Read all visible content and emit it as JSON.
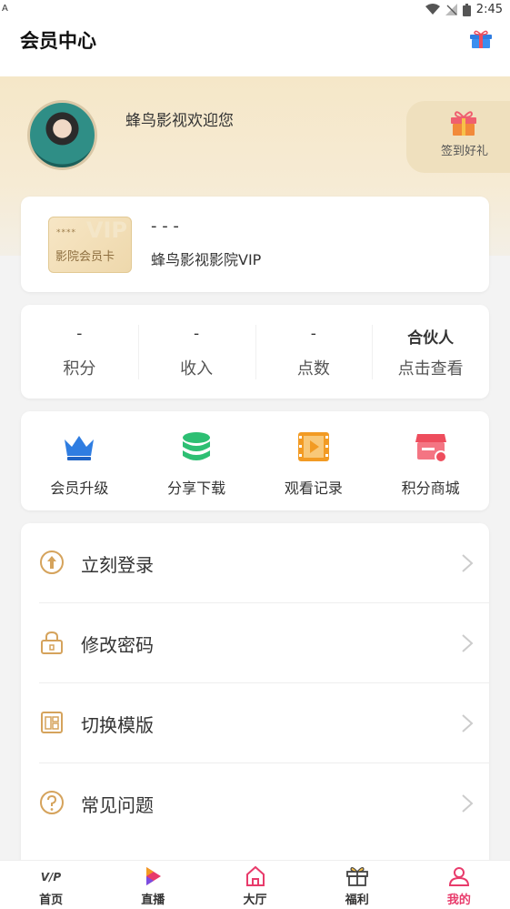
{
  "status_bar": {
    "left_indicator": "A",
    "time": "2:45"
  },
  "header": {
    "title": "会员中心",
    "gift_icon": "gift-icon"
  },
  "profile": {
    "welcome_text": "蜂鸟影视欢迎您",
    "signin_label": "签到好礼"
  },
  "vip_card": {
    "card_stars": "****",
    "card_watermark": "VIP",
    "card_name": "影院会员卡",
    "status": "- - -",
    "title": "蜂鸟影视影院VIP"
  },
  "stats": [
    {
      "value": "-",
      "label": "积分"
    },
    {
      "value": "-",
      "label": "收入"
    },
    {
      "value": "-",
      "label": "点数"
    },
    {
      "value": "合伙人",
      "label": "点击查看"
    }
  ],
  "quick_actions": [
    {
      "label": "会员升级",
      "icon": "crown-icon",
      "color": "#2f7de1"
    },
    {
      "label": "分享下载",
      "icon": "coin-stack-icon",
      "color": "#2dbf73"
    },
    {
      "label": "观看记录",
      "icon": "film-icon",
      "color": "#f29b24"
    },
    {
      "label": "积分商城",
      "icon": "store-icon",
      "color": "#ee4d5d"
    }
  ],
  "menu": [
    {
      "label": "立刻登录",
      "icon": "login-arrow-icon"
    },
    {
      "label": "修改密码",
      "icon": "lock-icon"
    },
    {
      "label": "切换模版",
      "icon": "template-icon"
    },
    {
      "label": "常见问题",
      "icon": "question-icon"
    }
  ],
  "tabs": [
    {
      "label": "首页",
      "icon": "vip-icon",
      "active": false
    },
    {
      "label": "直播",
      "icon": "live-play-icon",
      "active": false
    },
    {
      "label": "大厅",
      "icon": "home-icon",
      "active": false
    },
    {
      "label": "福利",
      "icon": "gift-box-icon",
      "active": false
    },
    {
      "label": "我的",
      "icon": "user-icon",
      "active": true
    }
  ],
  "colors": {
    "accent": "#e83b6b",
    "gold": "#d5a35c",
    "hero": "#f5e7c8"
  }
}
